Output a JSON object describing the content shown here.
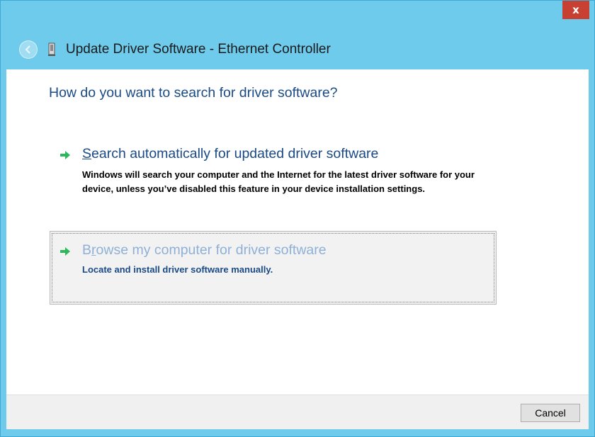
{
  "window": {
    "title": "Update Driver Software - Ethernet Controller",
    "close_label": "x"
  },
  "main": {
    "prompt": "How do you want to search for driver software?",
    "options": [
      {
        "accelerator": "S",
        "title_rest": "earch automatically for updated driver software",
        "description": "Windows will search your computer and the Internet for the latest driver software for your device, unless you’ve disabled this feature in your device installation settings."
      },
      {
        "title_pre": "B",
        "accelerator": "r",
        "title_rest": "owse my computer for driver software",
        "description": "Locate and install driver software manually."
      }
    ]
  },
  "footer": {
    "cancel_label": "Cancel"
  },
  "icons": {
    "back": "back-arrow-icon",
    "device": "network-adapter-icon",
    "option_arrow": "green-arrow-icon"
  },
  "colors": {
    "titlebar": "#6ecbec",
    "close": "#c84031",
    "heading_blue": "#1a4a86",
    "highlight_text": "#8fb0d6",
    "arrow_green": "#2eb85c"
  }
}
